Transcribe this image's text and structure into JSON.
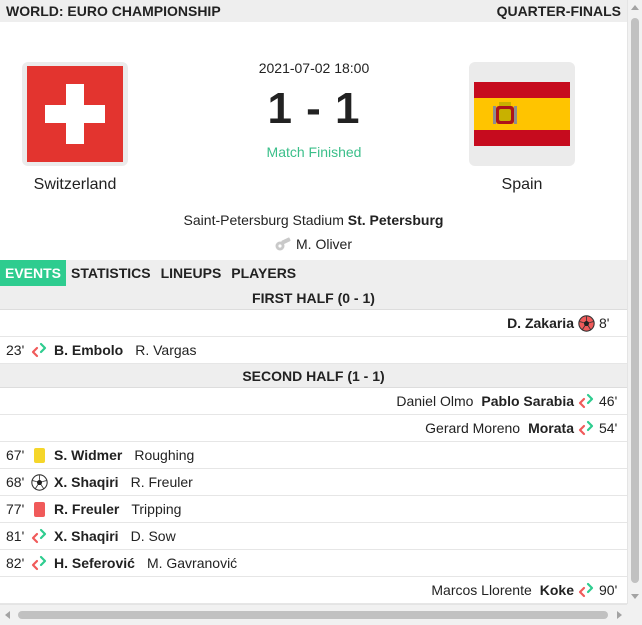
{
  "header": {
    "competition": "WORLD: EURO CHAMPIONSHIP",
    "round": "QUARTER-FINALS"
  },
  "match": {
    "datetime": "2021-07-02 18:00",
    "score": "1 - 1",
    "status": "Match Finished",
    "home": {
      "name": "Switzerland"
    },
    "away": {
      "name": "Spain"
    },
    "venue": {
      "stadium": "Saint-Petersburg Stadium",
      "city": "St. Petersburg"
    },
    "referee": "M. Oliver"
  },
  "tabs": [
    {
      "label": "EVENTS",
      "active": true
    },
    {
      "label": "STATISTICS",
      "active": false
    },
    {
      "label": "LINEUPS",
      "active": false
    },
    {
      "label": "PLAYERS",
      "active": false
    }
  ],
  "sections": [
    {
      "title": "FIRST HALF (0 - 1)",
      "events": [
        {
          "side": "away",
          "minute": "8'",
          "type": "own-goal",
          "icon": "own-goal-icon",
          "player": "D. Zakaria",
          "detail": ""
        },
        {
          "side": "home",
          "minute": "23'",
          "type": "substitution",
          "icon": "substitution-icon",
          "player": "B. Embolo",
          "detail": "R. Vargas"
        }
      ]
    },
    {
      "title": "SECOND HALF (1 - 1)",
      "events": [
        {
          "side": "away",
          "minute": "46'",
          "type": "substitution",
          "icon": "substitution-icon",
          "player": "Pablo Sarabia",
          "detail": "Daniel Olmo"
        },
        {
          "side": "away",
          "minute": "54'",
          "type": "substitution",
          "icon": "substitution-icon",
          "player": "Morata",
          "detail": "Gerard Moreno"
        },
        {
          "side": "home",
          "minute": "67'",
          "type": "yellow-card",
          "icon": "yellow-card-icon",
          "player": "S. Widmer",
          "detail": "Roughing"
        },
        {
          "side": "home",
          "minute": "68'",
          "type": "goal",
          "icon": "goal-icon",
          "player": "X. Shaqiri",
          "detail": "R. Freuler"
        },
        {
          "side": "home",
          "minute": "77'",
          "type": "red-card",
          "icon": "red-card-icon",
          "player": "R. Freuler",
          "detail": "Tripping"
        },
        {
          "side": "home",
          "minute": "81'",
          "type": "substitution",
          "icon": "substitution-icon",
          "player": "X. Shaqiri",
          "detail": "D. Sow"
        },
        {
          "side": "home",
          "minute": "82'",
          "type": "substitution",
          "icon": "substitution-icon",
          "player": "H. Seferović",
          "detail": "M. Gavranović"
        },
        {
          "side": "away",
          "minute": "90'",
          "type": "substitution",
          "icon": "substitution-icon",
          "player": "Koke",
          "detail": "Marcos Llorente"
        }
      ]
    }
  ],
  "colors": {
    "accent": "#2ecc8f",
    "status": "#3bbf8a",
    "yellow_card": "#f5d62a",
    "red_card": "#f05a5a",
    "swiss_red": "#e3342f",
    "spain_red": "#c60b1e",
    "spain_yellow": "#ffc400"
  }
}
